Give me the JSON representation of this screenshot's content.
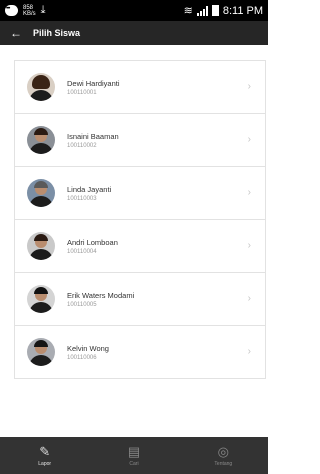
{
  "status_bar": {
    "speed_top": "858",
    "speed_bottom": "KB/s",
    "time": "8:11 PM"
  },
  "app_bar": {
    "title": "Pilih Siswa"
  },
  "students": [
    {
      "name": "Dewi Hardiyanti",
      "id": "100110001"
    },
    {
      "name": "Isnaini Baaman",
      "id": "100110002"
    },
    {
      "name": "Linda Jayanti",
      "id": "100110003"
    },
    {
      "name": "Andri Lomboan",
      "id": "100110004"
    },
    {
      "name": "Erik Waters Modami",
      "id": "100110005"
    },
    {
      "name": "Kelvin Wong",
      "id": "100110006"
    }
  ],
  "bottom_nav": [
    {
      "label": "Lapor",
      "icon": "edit-icon",
      "active": true
    },
    {
      "label": "Cari",
      "icon": "document-icon",
      "active": false
    },
    {
      "label": "Tentang",
      "icon": "info-icon",
      "active": false
    }
  ]
}
